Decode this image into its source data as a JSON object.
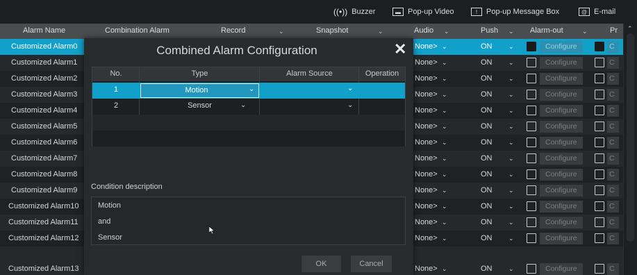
{
  "toolbar": {
    "buzzer": "Buzzer",
    "popup_video": "Pop-up Video",
    "popup_message": "Pop-up Message Box",
    "email": "E-mail"
  },
  "columns": {
    "alarm_name": "Alarm Name",
    "combination_alarm": "Combination Alarm",
    "record": "Record",
    "snapshot": "Snapshot",
    "audio": "Audio",
    "push": "Push",
    "alarm_out": "Alarm-out",
    "preset": "Pr"
  },
  "rows": [
    {
      "name": "Customized Alarm0",
      "audio": "None>",
      "push": "ON",
      "configure": "Configure"
    },
    {
      "name": "Customized Alarm1",
      "audio": "None>",
      "push": "ON",
      "configure": "Configure"
    },
    {
      "name": "Customized Alarm2",
      "audio": "None>",
      "push": "ON",
      "configure": "Configure"
    },
    {
      "name": "Customized Alarm3",
      "audio": "None>",
      "push": "ON",
      "configure": "Configure"
    },
    {
      "name": "Customized Alarm4",
      "audio": "None>",
      "push": "ON",
      "configure": "Configure"
    },
    {
      "name": "Customized Alarm5",
      "audio": "None>",
      "push": "ON",
      "configure": "Configure"
    },
    {
      "name": "Customized Alarm6",
      "audio": "None>",
      "push": "ON",
      "configure": "Configure"
    },
    {
      "name": "Customized Alarm7",
      "audio": "None>",
      "push": "ON",
      "configure": "Configure"
    },
    {
      "name": "Customized Alarm8",
      "audio": "None>",
      "push": "ON",
      "configure": "Configure"
    },
    {
      "name": "Customized Alarm9",
      "audio": "None>",
      "push": "ON",
      "configure": "Configure"
    },
    {
      "name": "Customized Alarm10",
      "audio": "None>",
      "push": "ON",
      "configure": "Configure"
    },
    {
      "name": "Customized Alarm11",
      "audio": "None>",
      "push": "ON",
      "configure": "Configure"
    },
    {
      "name": "Customized Alarm12",
      "audio": "None>",
      "push": "ON",
      "configure": "Configure"
    },
    {
      "name": "Customized Alarm13",
      "audio": "None>",
      "push": "ON",
      "configure": "Configure"
    }
  ],
  "dialog": {
    "title": "Combined Alarm Configuration",
    "headers": {
      "no": "No.",
      "type": "Type",
      "source": "Alarm Source",
      "operation": "Operation"
    },
    "items": [
      {
        "no": "1",
        "type": "Motion",
        "source": ""
      },
      {
        "no": "2",
        "type": "Sensor",
        "source": ""
      }
    ],
    "condition_label": "Condition description",
    "condition_lines": [
      "Motion",
      "and",
      "Sensor"
    ],
    "ok": "OK",
    "cancel": "Cancel"
  },
  "colors": {
    "accent": "#11a0c9",
    "header_bg": "#4a4d50",
    "dialog_bg": "#282b2e"
  }
}
